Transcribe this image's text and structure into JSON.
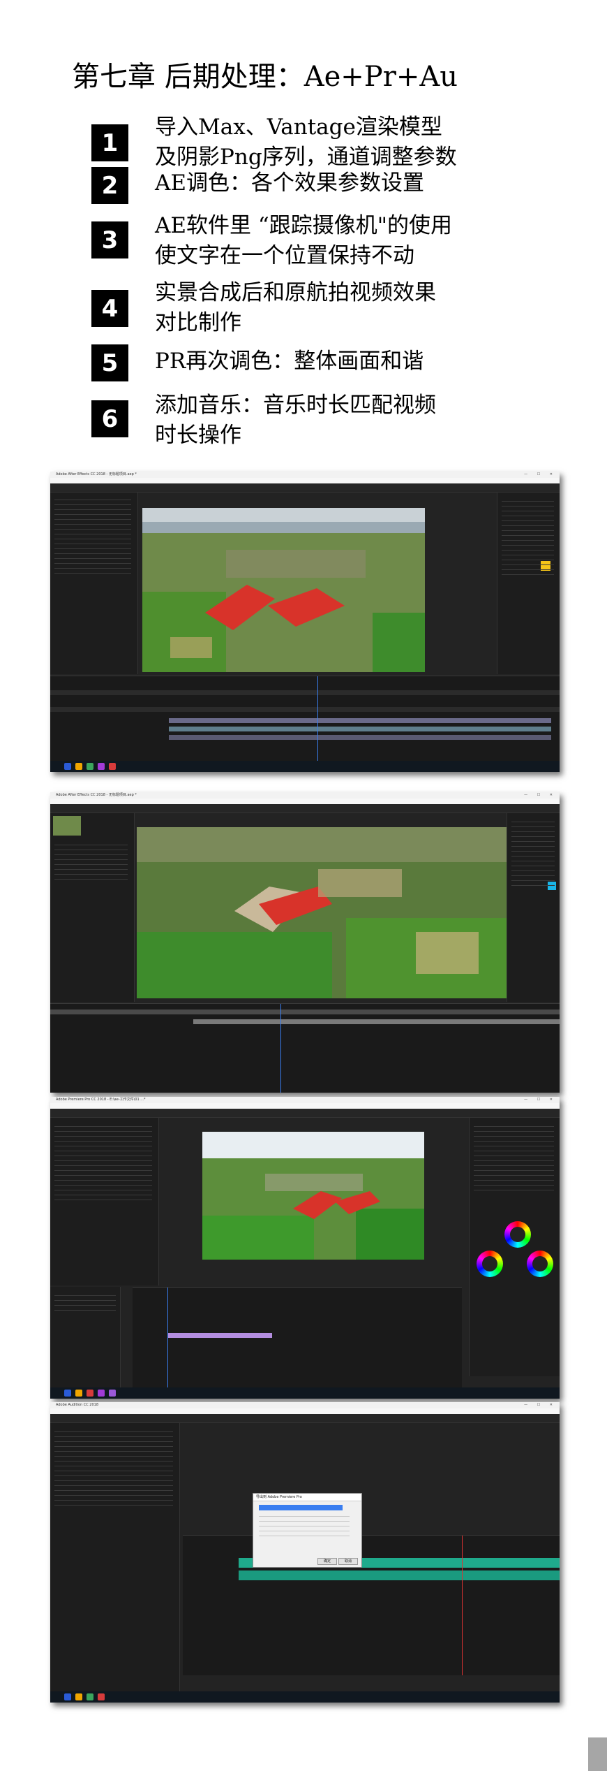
{
  "chapter_title": "第七章 后期处理：Ae+Pr+Au",
  "steps": [
    {
      "num": "1",
      "text": "导入Max、Vantage渲染模型\n及阴影Png序列，通道调整参数"
    },
    {
      "num": "2",
      "text": "AE调色：各个效果参数设置"
    },
    {
      "num": "3",
      "text": "AE软件里 “跟踪摄像机\"的使用\n使文字在一个位置保持不动"
    },
    {
      "num": "4",
      "text": "实景合成后和原航拍视频效果\n对比制作"
    },
    {
      "num": "5",
      "text": "PR再次调色：整体画面和谐"
    },
    {
      "num": "6",
      "text": "添加音乐：音乐时长匹配视频\n时长操作"
    }
  ],
  "screenshots": [
    {
      "app": "Adobe After Effects",
      "window_title": "Adobe After Effects CC 2018 - 无标题项目.aep *",
      "window_controls": "— ☐ ✕"
    },
    {
      "app": "Adobe After Effects",
      "window_title": "Adobe After Effects CC 2018 - 无标题项目.aep *",
      "window_controls": "— ☐ ✕"
    },
    {
      "app": "Adobe Premiere Pro",
      "window_title": "Adobe Premiere Pro CC 2018 - E:\\ae-工作文件\\01 ...*",
      "window_controls": "— ☐ ✕"
    },
    {
      "app": "Adobe Audition",
      "window_title": "Adobe Audition CC 2018",
      "window_controls": "— ☐ ✕",
      "dialog": {
        "title": "导出到 Adobe Premiere Pro",
        "ok": "确定",
        "cancel": "取消"
      }
    }
  ],
  "colors": {
    "roof_red": "#d8332a",
    "field_green": "#3e8c2c",
    "audio_wave": "#1faa8c",
    "ui_dark": "#232323",
    "accent_blue": "#3a7ef0"
  }
}
